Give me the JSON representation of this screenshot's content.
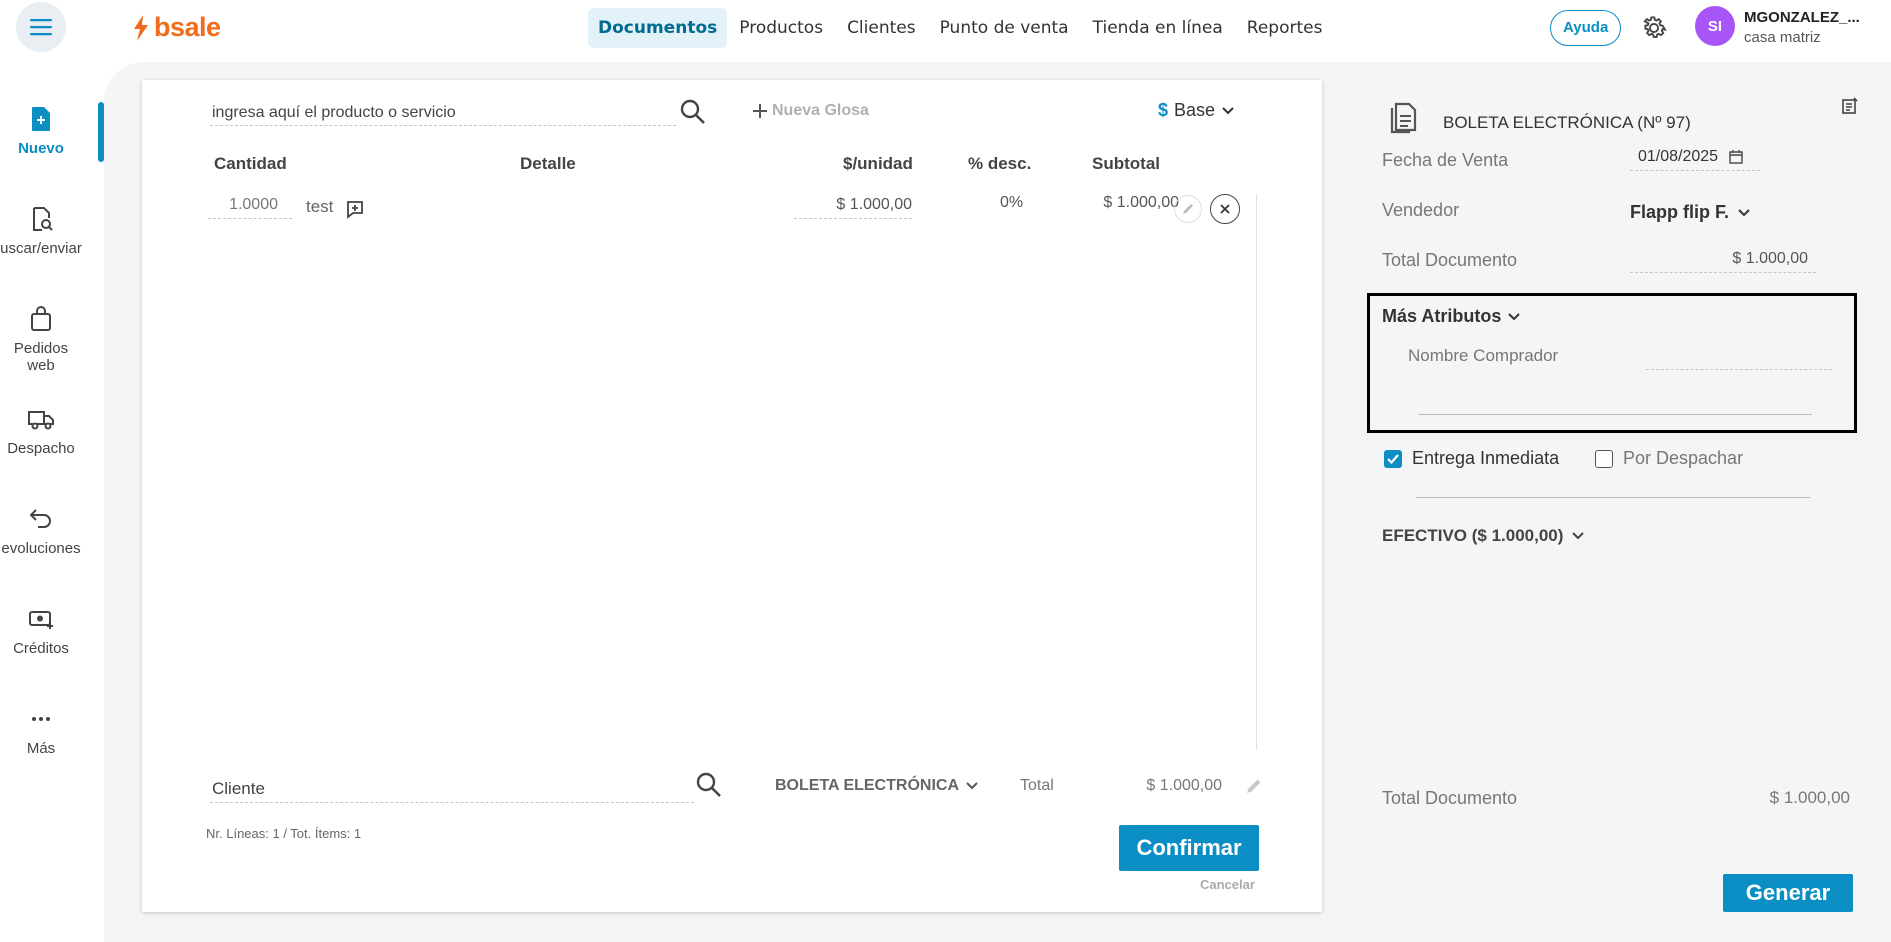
{
  "topbar": {
    "logo_text": "bsale",
    "nav": [
      {
        "label": "Documentos",
        "active": true
      },
      {
        "label": "Productos",
        "active": false
      },
      {
        "label": "Clientes",
        "active": false
      },
      {
        "label": "Punto de venta",
        "active": false
      },
      {
        "label": "Tienda en línea",
        "active": false
      },
      {
        "label": "Reportes",
        "active": false
      }
    ],
    "help_label": "Ayuda",
    "avatar_initials": "SI",
    "user_name": "MGONZALEZ_...",
    "user_branch": "casa matriz"
  },
  "sidebar": {
    "items": [
      {
        "label": "Nuevo",
        "icon": "new-document-icon",
        "active": true
      },
      {
        "label": "uscar/enviar",
        "icon": "document-search-icon",
        "active": false
      },
      {
        "label": "Pedidos web",
        "icon": "shopping-bag-icon",
        "active": false
      },
      {
        "label": "Despacho",
        "icon": "truck-icon",
        "active": false
      },
      {
        "label": "evoluciones",
        "icon": "return-arrow-icon",
        "active": false
      },
      {
        "label": "Créditos",
        "icon": "money-icon",
        "active": false
      },
      {
        "label": "Más",
        "icon": "more-icon",
        "active": false
      }
    ]
  },
  "document": {
    "search_value": "ingresa aquí el producto o servicio",
    "new_gloss_label": "Nueva Glosa",
    "currency_symbol": "$",
    "price_list": "Base",
    "columns": {
      "quantity": "Cantidad",
      "detail": "Detalle",
      "unit_price": "$/unidad",
      "discount": "% desc.",
      "subtotal": "Subtotal"
    },
    "rows": [
      {
        "quantity": "1.0000",
        "detail": "test",
        "unit_price": "$ 1.000,00",
        "discount": "0%",
        "subtotal": "$ 1.000,00"
      }
    ],
    "client_value": "Cliente",
    "doc_type": "BOLETA ELECTRÓNICA",
    "total_label": "Total",
    "total_value": "$ 1.000,00",
    "lines_info": "Nr. Líneas: 1 / Tot. Ítems: 1",
    "confirm_label": "Confirmar",
    "cancel_label": "Cancelar"
  },
  "summary": {
    "title": "BOLETA ELECTRÓNICA (Nº 97)",
    "sale_date_label": "Fecha de Venta",
    "sale_date_value": "01/08/2025",
    "seller_label": "Vendedor",
    "seller_value": "Flapp flip F.",
    "total_doc_label": "Total Documento",
    "total_doc_value": "$ 1.000,00",
    "more_attributes_label": "Más Atributos",
    "buyer_name_label": "Nombre Comprador",
    "immediate_delivery_label": "Entrega Inmediata",
    "immediate_delivery_checked": true,
    "to_dispatch_label": "Por Despachar",
    "to_dispatch_checked": false,
    "payment_label": "EFECTIVO ($ 1.000,00)",
    "bottom_total_label": "Total Documento",
    "bottom_total_value": "$ 1.000,00",
    "generate_label": "Generar"
  },
  "colors": {
    "accent": "#0a8ec4",
    "brand": "#f26b1d",
    "avatar": "#a855f7"
  }
}
